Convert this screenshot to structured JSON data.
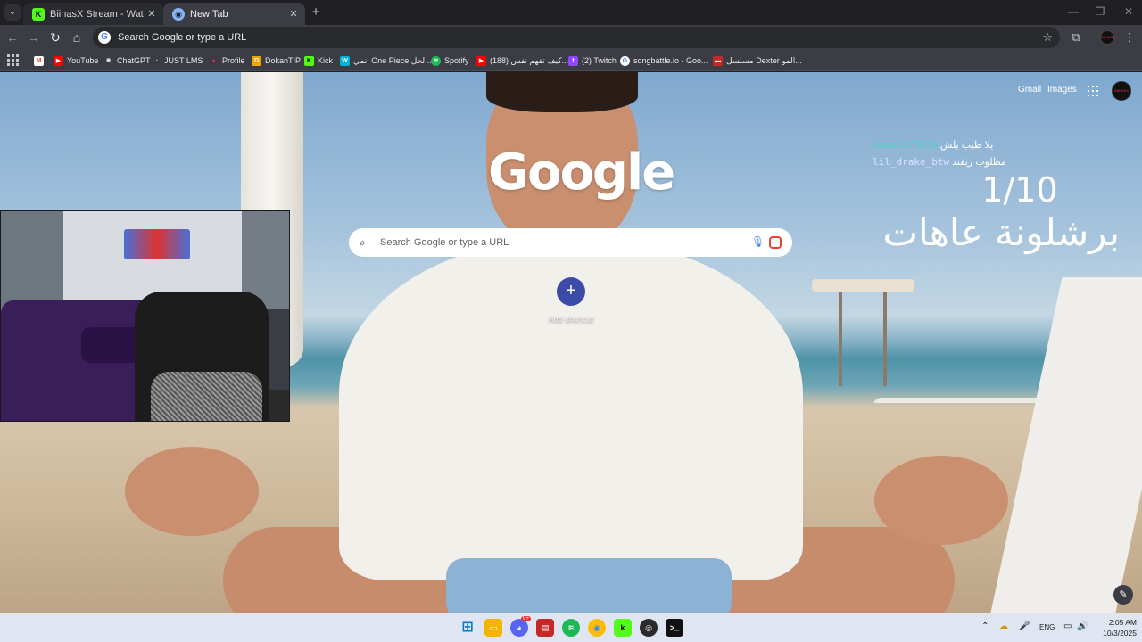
{
  "browser": {
    "tabs": [
      {
        "title": "BiihasX Stream - Watch Live on",
        "favicon": "kick-icon",
        "active": false
      },
      {
        "title": "New Tab",
        "favicon": "chrome-icon",
        "active": true
      }
    ],
    "omnibox": {
      "placeholder": "Search Google or type a URL"
    },
    "bookmarks": [
      {
        "label": "",
        "icon": "gmail-icon"
      },
      {
        "label": "YouTube",
        "icon": "youtube-icon"
      },
      {
        "label": "ChatGPT",
        "icon": "chatgpt-icon"
      },
      {
        "label": "JUST LMS",
        "icon": "just-icon"
      },
      {
        "label": "Profile",
        "icon": "profile-icon"
      },
      {
        "label": "DokanTIP",
        "icon": "dokantip-icon"
      },
      {
        "label": "Kick",
        "icon": "kick-icon"
      },
      {
        "label": "انمي One Piece الحل...",
        "icon": "w-icon"
      },
      {
        "label": "Spotify",
        "icon": "spotify-icon"
      },
      {
        "label": "(188) كيف تفهم نفس...",
        "icon": "youtube-icon"
      },
      {
        "label": "(2) Twitch",
        "icon": "twitch-icon"
      },
      {
        "label": "songbattle.io - Goo...",
        "icon": "google-icon"
      },
      {
        "label": "مسلسل Dexter المو...",
        "icon": "flag-icon"
      }
    ]
  },
  "ntp": {
    "header_links": {
      "gmail": "Gmail",
      "images": "Images"
    },
    "avatar_text": "BIIHASX",
    "logo_text": "Google",
    "search_placeholder": "Search Google or type a URL",
    "add_shortcut_label": "Add shortcut"
  },
  "stream_overlay": {
    "chat": [
      {
        "user": "ahmad175639",
        "message": "يلا طيب يلش",
        "color": "#4fd1c5"
      },
      {
        "user": "lil_drake_btw",
        "message": "مطلوب ريفند",
        "color": "#d8e4ff"
      }
    ],
    "counter": "1/10",
    "title": "برشلونة عاهات"
  },
  "taskbar": {
    "apps": [
      "windows-start-icon",
      "file-explorer-icon",
      "discord-icon",
      "pressreader-icon",
      "spotify-icon",
      "chrome-icon",
      "kick-app-icon",
      "obs-icon",
      "terminal-icon"
    ],
    "discord_badge": "9+",
    "tray": {
      "language": "ENG"
    },
    "clock": {
      "time": "2:05 AM",
      "date": "10/3/2025"
    }
  },
  "colors": {
    "accent": "#3c4aa8",
    "tab_bg": "#3c3c44",
    "frame_bg": "#1f1f24",
    "kick_green": "#53fc18"
  }
}
